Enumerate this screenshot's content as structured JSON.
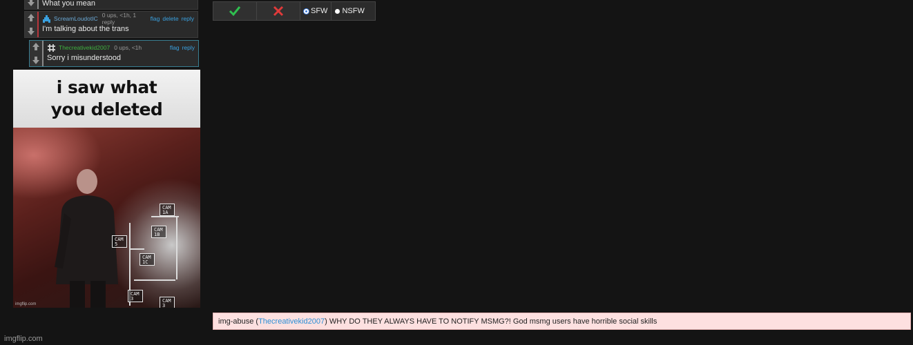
{
  "comments": [
    {
      "username": "",
      "meta": "",
      "text": "What you mean",
      "actions": []
    },
    {
      "username": "ScreamLoudotIC",
      "meta": "0 ups, <1h, 1 reply",
      "text": "I'm talking about the trans",
      "actions": [
        "flag",
        "delete",
        "reply"
      ]
    },
    {
      "username": "Thecreativekid2007",
      "meta": "0 ups, <1h",
      "text": "Sorry i misunderstood",
      "actions": [
        "flag",
        "reply"
      ]
    }
  ],
  "meme": {
    "caption": "i saw what you deleted",
    "cams": [
      "CAM 1A",
      "CAM 1B",
      "CAM 5",
      "CAM 1C",
      "CAM 3",
      "CAM 3"
    ],
    "watermark": "imgflip.com"
  },
  "moderation": {
    "approve_icon": "check-icon",
    "reject_icon": "x-icon",
    "options": [
      "SFW",
      "NSFW"
    ],
    "selected": "SFW"
  },
  "abuse_notice": {
    "prefix": "img-abuse (",
    "user": "Thecreativekid2007",
    "suffix": ") WHY DO THEY ALWAYS HAVE TO NOTIFY MSMG?! God msmg users have horrible social skills"
  },
  "watermark": "imgflip.com",
  "colors": {
    "background": "#141414",
    "link": "#3aa1e0",
    "approve": "#2fbf4f",
    "reject": "#e03a3a",
    "abuse_bg": "#fde0e0"
  }
}
